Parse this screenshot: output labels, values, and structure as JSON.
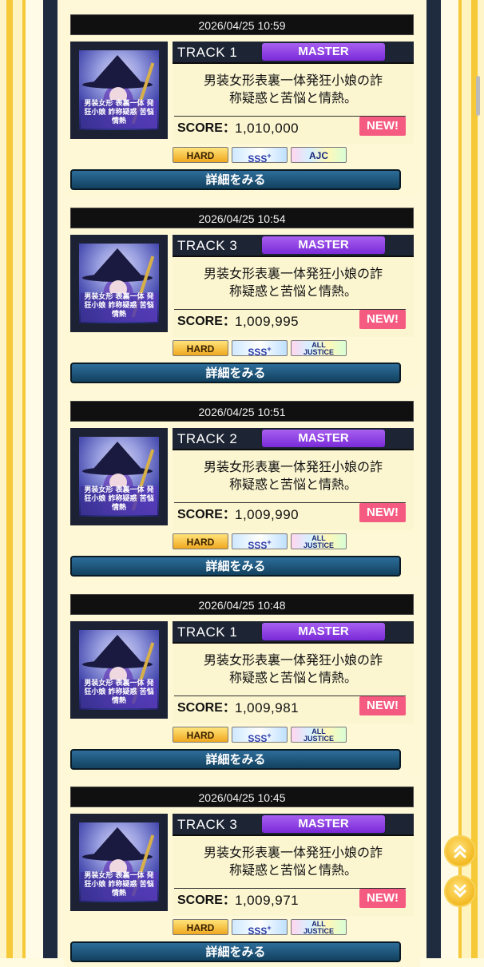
{
  "lamp_labels": {
    "hard": "HARD",
    "sss": "SSS",
    "sss_plus": "+",
    "ajc": "AJC",
    "all_justice_1": "ALL",
    "all_justice_2": "JUSTICE"
  },
  "detail_label": "詳細をみる",
  "score_label": "SCORE：",
  "new_label": "NEW!",
  "jacket_text": "男装女形 表裏一体 発狂小娘 詐称疑惑 苦悩情熱",
  "entries": [
    {
      "datetime": "2026/04/25 10:59",
      "track": "TRACK 1",
      "difficulty": "MASTER",
      "title": "男装女形表裏一体発狂小娘の詐称疑惑と苦悩と情熱。",
      "score": "1,010,000",
      "lamps": [
        "HARD",
        "SSS+",
        "AJC"
      ]
    },
    {
      "datetime": "2026/04/25 10:54",
      "track": "TRACK 3",
      "difficulty": "MASTER",
      "title": "男装女形表裏一体発狂小娘の詐称疑惑と苦悩と情熱。",
      "score": "1,009,995",
      "lamps": [
        "HARD",
        "SSS+",
        "ALL JUSTICE"
      ]
    },
    {
      "datetime": "2026/04/25 10:51",
      "track": "TRACK 2",
      "difficulty": "MASTER",
      "title": "男装女形表裏一体発狂小娘の詐称疑惑と苦悩と情熱。",
      "score": "1,009,990",
      "lamps": [
        "HARD",
        "SSS+",
        "ALL JUSTICE"
      ]
    },
    {
      "datetime": "2026/04/25 10:48",
      "track": "TRACK 1",
      "difficulty": "MASTER",
      "title": "男装女形表裏一体発狂小娘の詐称疑惑と苦悩と情熱。",
      "score": "1,009,981",
      "lamps": [
        "HARD",
        "SSS+",
        "ALL JUSTICE"
      ]
    },
    {
      "datetime": "2026/04/25 10:45",
      "track": "TRACK 3",
      "difficulty": "MASTER",
      "title": "男装女形表裏一体発狂小娘の詐称疑惑と苦悩と情熱。",
      "score": "1,009,971",
      "lamps": [
        "HARD",
        "SSS+",
        "ALL JUSTICE"
      ]
    }
  ],
  "scroll_buttons": {
    "up_icon": "double-chevron-up-icon",
    "down_icon": "double-chevron-down-icon"
  }
}
